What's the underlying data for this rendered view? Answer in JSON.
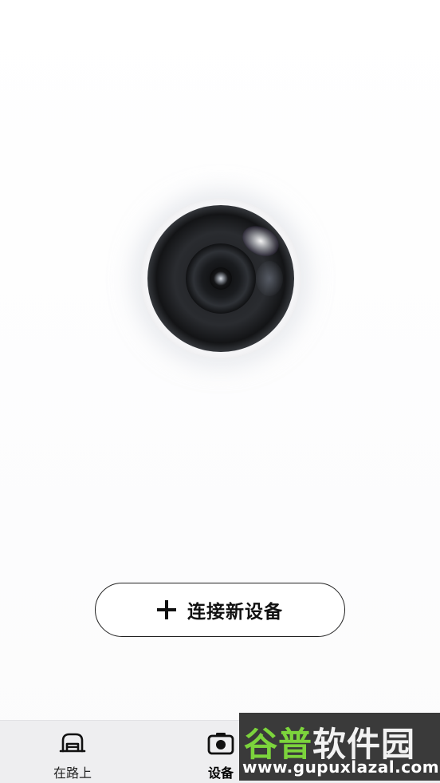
{
  "main": {
    "connect_button_label": "连接新设备",
    "connect_icon": "plus-icon",
    "hero_image": "camera-lens-illustration"
  },
  "tabbar": {
    "tabs": [
      {
        "label": "在路上",
        "icon": "car-icon",
        "active": false
      },
      {
        "label": "设备",
        "icon": "camera-icon",
        "active": true
      }
    ]
  },
  "watermark": {
    "title_part1": "谷普",
    "title_part2": "软件园",
    "url": "www.gupuxlazal.com"
  },
  "colors": {
    "background": "#ffffff",
    "tabbar_background": "#eeeef0",
    "watermark_green": "#7cd43c"
  }
}
